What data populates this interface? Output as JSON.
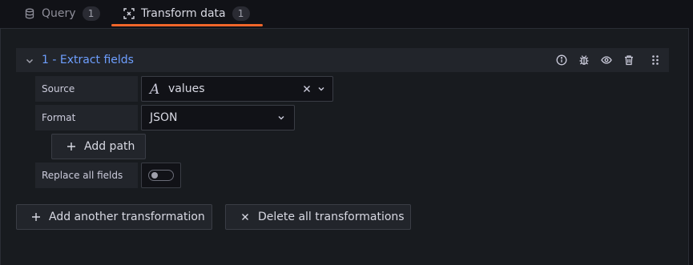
{
  "tabs": [
    {
      "label": "Query",
      "count": "1",
      "icon": "database-icon"
    },
    {
      "label": "Transform data",
      "count": "1",
      "icon": "transform-icon"
    }
  ],
  "transformation": {
    "title": "1 - Extract fields",
    "header_icons": [
      "info-icon",
      "bug-icon",
      "eye-icon",
      "trash-icon",
      "drag-handle-icon"
    ]
  },
  "fields": {
    "source_label": "Source",
    "source_value": "values",
    "source_icon": "field-name-icon",
    "format_label": "Format",
    "format_value": "JSON",
    "add_path_label": "Add path",
    "replace_label": "Replace all fields",
    "replace_enabled": false
  },
  "actions": {
    "add_label": "Add another transformation",
    "delete_label": "Delete all transformations"
  },
  "colors": {
    "accent_tab": "#f0662a",
    "title_blue": "#6e9fff",
    "background": "#111217"
  }
}
